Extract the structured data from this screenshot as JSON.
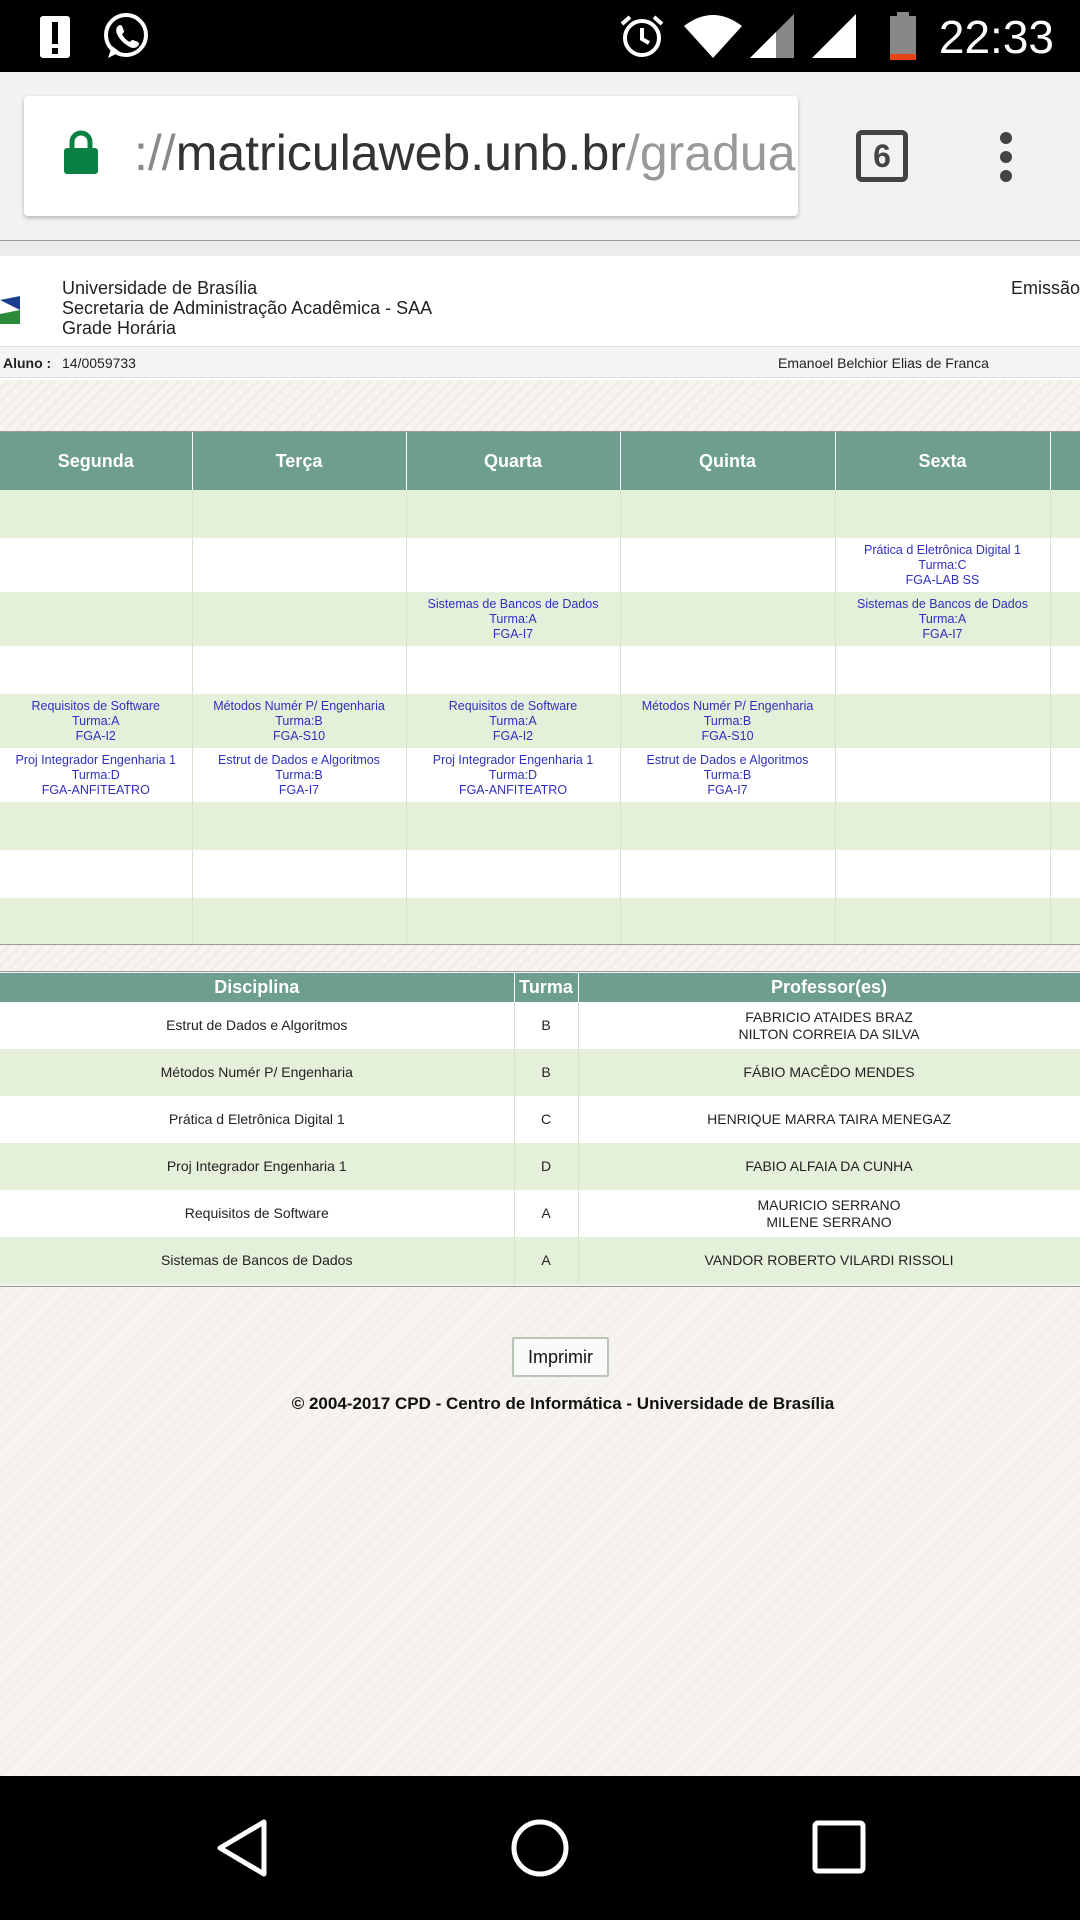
{
  "status_bar": {
    "time": "22:33",
    "icons": [
      "alert-icon",
      "whatsapp-icon",
      "alarm-icon",
      "wifi-icon",
      "signal-icon",
      "battery-icon"
    ]
  },
  "browser": {
    "url_scheme": "://",
    "url_host": "matriculaweb.unb.br",
    "url_path": "/gradua",
    "tab_count": "6"
  },
  "header": {
    "institution": "Universidade de Brasília",
    "secretariat": "Secretaria de Administração Acadêmica - SAA",
    "doc_title": "Grade Horária",
    "emissao": "Emissão",
    "aluno_label": "Aluno :",
    "aluno_matricula": "14/0059733",
    "aluno_nome": "Emanoel Belchior Elias de Franca"
  },
  "schedule": {
    "days": [
      "Segunda",
      "Terça",
      "Quarta",
      "Quinta",
      "Sexta"
    ],
    "rows": [
      [
        "",
        "",
        "",
        "",
        ""
      ],
      [
        "",
        "",
        "",
        "",
        "Prática d Eletrônica Digital 1|Turma:C|FGA-LAB SS"
      ],
      [
        "",
        "",
        "Sistemas de Bancos de Dados|Turma:A|FGA-I7",
        "",
        "Sistemas de Bancos de Dados|Turma:A|FGA-I7"
      ],
      [
        "",
        "",
        "",
        "",
        ""
      ],
      [
        "Requisitos de Software|Turma:A|FGA-I2",
        "Métodos Numér P/ Engenharia|Turma:B|FGA-S10",
        "Requisitos de Software|Turma:A|FGA-I2",
        "Métodos Numér P/ Engenharia|Turma:B|FGA-S10",
        ""
      ],
      [
        "Proj Integrador Engenharia 1|Turma:D|FGA-ANFITEATRO",
        "Estrut de Dados e Algoritmos|Turma:B|FGA-I7",
        "Proj Integrador Engenharia 1|Turma:D|FGA-ANFITEATRO",
        "Estrut de Dados e Algoritmos|Turma:B|FGA-I7",
        ""
      ],
      [
        "",
        "",
        "",
        "",
        ""
      ],
      [
        "",
        "",
        "",
        "",
        ""
      ],
      [
        "",
        "",
        "",
        "",
        ""
      ]
    ]
  },
  "disciplines": {
    "headers": [
      "Disciplina",
      "Turma",
      "Professor(es)"
    ],
    "rows": [
      {
        "disciplina": "Estrut de Dados e Algoritmos",
        "turma": "B",
        "professores": [
          "FABRICIO ATAIDES BRAZ",
          "NILTON CORREIA DA SILVA"
        ]
      },
      {
        "disciplina": "Métodos Numér P/ Engenharia",
        "turma": "B",
        "professores": [
          "FÁBIO MACÊDO MENDES"
        ]
      },
      {
        "disciplina": "Prática d Eletrônica Digital 1",
        "turma": "C",
        "professores": [
          "HENRIQUE MARRA TAIRA MENEGAZ"
        ]
      },
      {
        "disciplina": "Proj Integrador Engenharia 1",
        "turma": "D",
        "professores": [
          "FABIO ALFAIA DA CUNHA"
        ]
      },
      {
        "disciplina": "Requisitos de Software",
        "turma": "A",
        "professores": [
          "MAURICIO SERRANO",
          "MILENE SERRANO"
        ]
      },
      {
        "disciplina": "Sistemas de Bancos de Dados",
        "turma": "A",
        "professores": [
          "VANDOR ROBERTO VILARDI RISSOLI"
        ]
      }
    ]
  },
  "print_button": "Imprimir",
  "footer": "© 2004-2017 CPD - Centro de Informática - Universidade de Brasília",
  "colors": {
    "header_green": "#6e9e8f",
    "row_green": "#e4f0da",
    "link_blue": "#3030c0"
  }
}
